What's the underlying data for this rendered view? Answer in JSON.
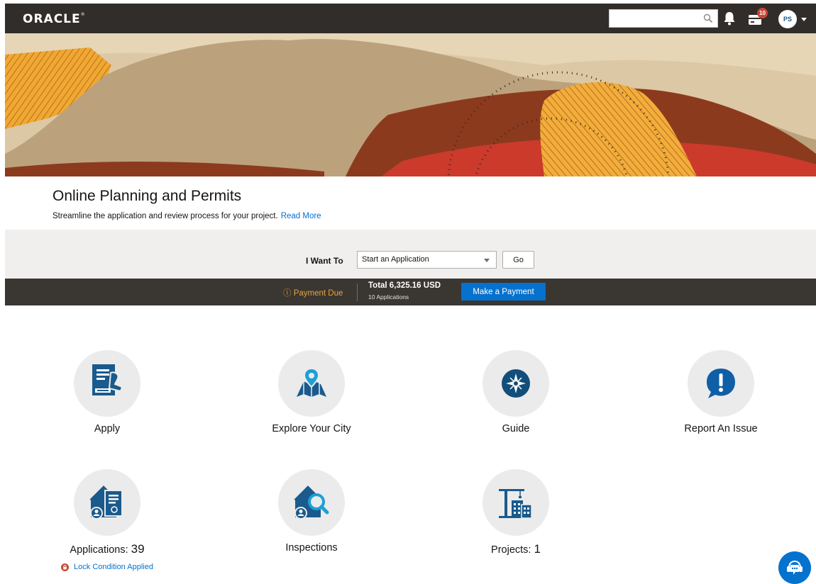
{
  "header": {
    "logo": "ORACLE",
    "logo_mark": "®",
    "search_value": "",
    "cart_count": "10",
    "avatar_initials": "PS"
  },
  "intro": {
    "title": "Online Planning and Permits",
    "subtitle": "Streamline the application and review process for your project.",
    "read_more": "Read More"
  },
  "iwant": {
    "label": "I Want To",
    "selected": "Start an Application",
    "go_label": "Go"
  },
  "payment": {
    "due_label": "ⓘ Payment Due",
    "total": "Total 6,325.16 USD",
    "count": "10 Applications",
    "pay_label": "Make a Payment"
  },
  "tiles": {
    "apply": {
      "label": "Apply"
    },
    "explore": {
      "label": "Explore Your City"
    },
    "guide": {
      "label": "Guide"
    },
    "report": {
      "label": "Report An Issue"
    },
    "applications": {
      "label": "Applications",
      "sep": ": ",
      "count": "39",
      "note": "Lock Condition Applied"
    },
    "inspections": {
      "label": "Inspections"
    },
    "projects": {
      "label": "Projects",
      "sep": ": ",
      "count": "1"
    }
  },
  "colors": {
    "topbar": "#312d2a",
    "accent_blue": "#0572ce",
    "icon_blue": "#1a5a8c",
    "payment_due": "#e8a33d",
    "badge_red": "#c74634",
    "tile_circle": "#ebebeb"
  },
  "icons": {
    "search": "search-icon",
    "notifications": "bell-icon",
    "cart": "cart-icon",
    "apply": "document-stamp-icon",
    "explore": "map-pin-icon",
    "guide": "compass-icon",
    "report": "exclamation-chat-icon",
    "applications": "house-document-icon",
    "inspections": "house-magnifier-icon",
    "projects": "crane-building-icon",
    "lock": "lock-icon",
    "chat": "chat-assistant-icon"
  }
}
